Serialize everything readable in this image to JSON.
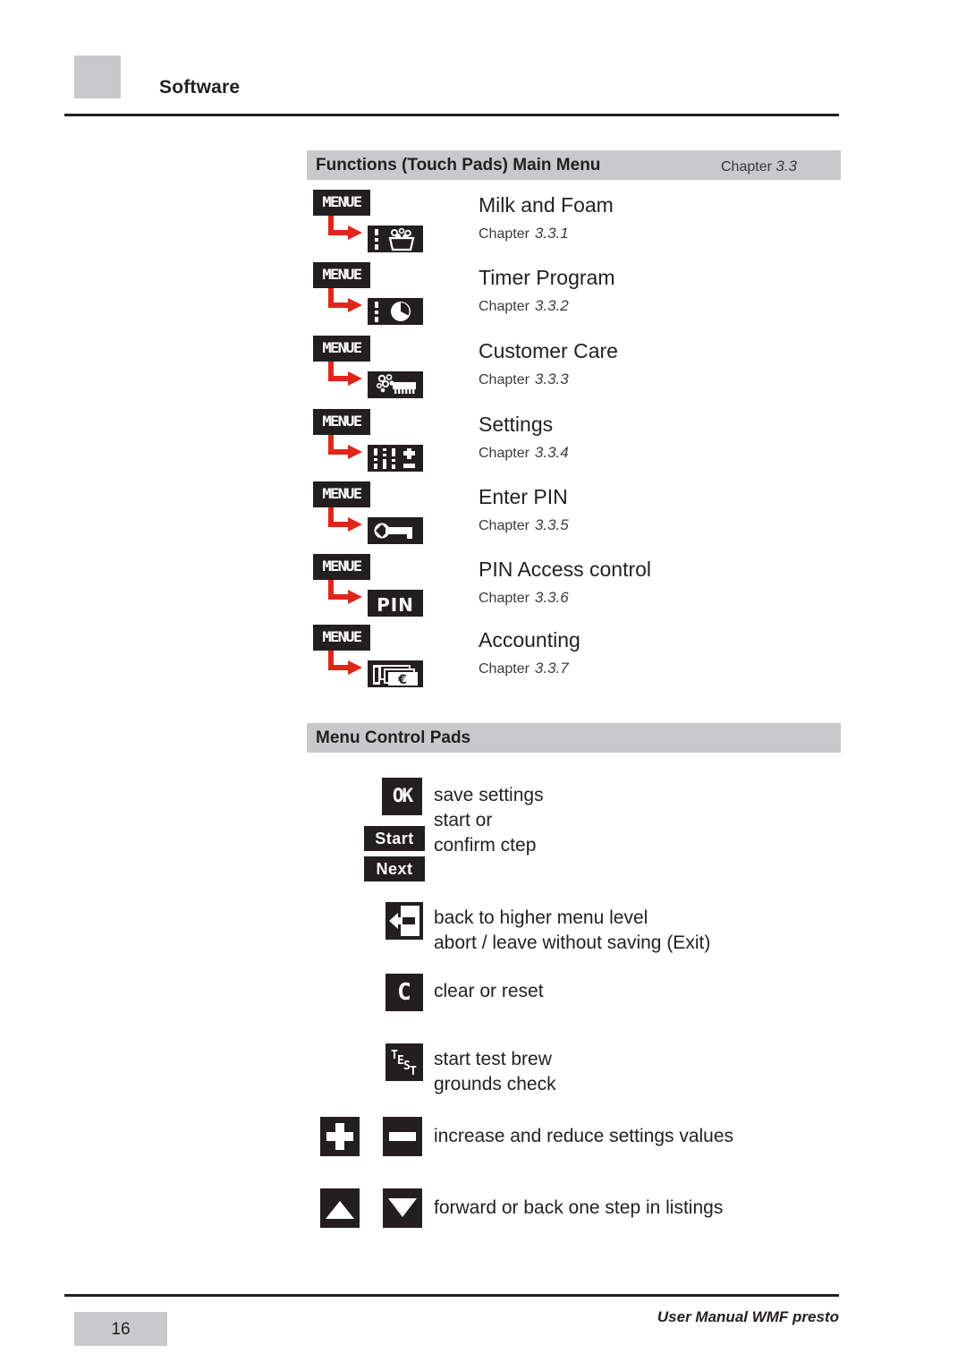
{
  "header": {
    "title": "Software"
  },
  "sections": {
    "functions": {
      "title": "Functions (Touch Pads) Main Menu",
      "chapter_label": "Chapter",
      "chapter_number": "3.3"
    },
    "control": {
      "title": "Menu Control Pads"
    }
  },
  "menu_pad_label": "MENUE",
  "menu_items": [
    {
      "pad": "MENUE",
      "icon": "milk-foam-icon",
      "label": "Milk and Foam",
      "chapter_label": "Chapter",
      "chapter_number": "3.3.1"
    },
    {
      "pad": "MENUE",
      "icon": "timer-clock-icon",
      "label": "Timer Program",
      "chapter_label": "Chapter",
      "chapter_number": "3.3.2"
    },
    {
      "pad": "MENUE",
      "icon": "cup-brush-icon",
      "label": "Customer Care",
      "chapter_label": "Chapter",
      "chapter_number": "3.3.3"
    },
    {
      "pad": "MENUE",
      "icon": "sliders-icon",
      "label": "Settings",
      "chapter_label": "Chapter",
      "chapter_number": "3.3.4"
    },
    {
      "pad": "MENUE",
      "icon": "key-icon",
      "label": "Enter PIN",
      "chapter_label": "Chapter",
      "chapter_number": "3.3.5"
    },
    {
      "pad": "MENUE",
      "icon": "pin-text-icon",
      "label": "PIN Access control",
      "chapter_label": "Chapter",
      "chapter_number": "3.3.6"
    },
    {
      "pad": "MENUE",
      "icon": "euro-notes-icon",
      "label": "Accounting",
      "chapter_label": "Chapter",
      "chapter_number": "3.3.7"
    }
  ],
  "control_pads": {
    "ok_label": "OK",
    "start_label": "Start",
    "next_label": "Next",
    "ok_desc_line1": "save settings",
    "ok_desc_line2": "start or",
    "ok_desc_line3": "confirm ctep",
    "back_desc_line1": "back to higher menu level",
    "back_desc_line2": "abort / leave without saving (Exit)",
    "clear_label": "C",
    "clear_desc": "clear or reset",
    "test_label": "TEST",
    "test_desc_line1": "start test brew",
    "test_desc_line2": "grounds check",
    "plusminus_desc": "increase and reduce settings values",
    "updown_desc": "forward or back one step in listings"
  },
  "footer": {
    "page_number": "16",
    "manual_title": "User Manual WMF presto"
  },
  "colors": {
    "bar_gray": "#c8c9cb",
    "ink": "#231f20",
    "arrow_red": "#e1251b"
  }
}
